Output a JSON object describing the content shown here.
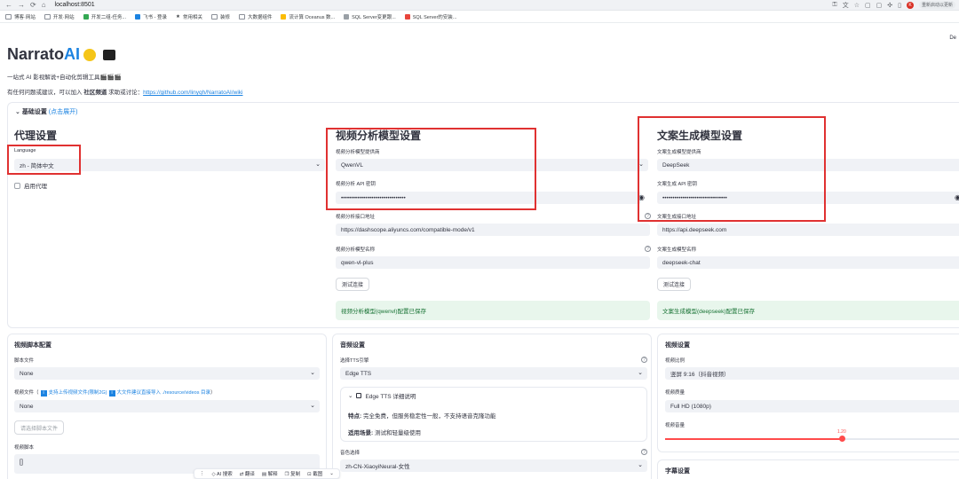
{
  "browser": {
    "url": "localhost:8501",
    "profile": "重新启动以更新",
    "avatar_letter": "K"
  },
  "bookmarks": [
    "博客·网站",
    "开发·网站",
    "开发二组-任务...",
    "飞书 - 登录",
    "常用相关",
    "装修",
    "大数据组件",
    "流计算 Oceanus 数...",
    "SQL Server变更跟...",
    "SQL Server的安装..."
  ],
  "app": {
    "deploy": "De",
    "title_prefix": "Narrato",
    "title_ai": "AI",
    "subtitle": "一站式 AI 影视解说+自动化剪辑工具🎬🎬🎬",
    "contact_text": "有任何问题或建议，可以加入 ",
    "contact_bold": "社区频道",
    "contact_mid": " 求助或讨论：",
    "contact_link": "https://github.com/linyqh/NarratoAI/wiki"
  },
  "basic_settings": {
    "label": "基础设置",
    "hint": "(点击展开)"
  },
  "proxy": {
    "title": "代理设置",
    "language_label": "Language",
    "language_value": "zh - 简体中文",
    "enable_proxy": "启用代理"
  },
  "video_model": {
    "title": "视频分析模型设置",
    "provider_label": "视频分析模型提供商",
    "provider_value": "QwenVL",
    "api_key_label": "视频分析 API 密钥",
    "api_key_value": "••••••••••••••••••••••••••••••••",
    "base_url_label": "视频分析接口地址",
    "base_url_value": "https://dashscope.aliyuncs.com/compatible-mode/v1",
    "model_name_label": "视频分析模型名称",
    "model_name_value": "qwen-vl-plus",
    "test_button": "测试连接",
    "status": "视频分析模型(qwenvl)配置已保存"
  },
  "text_model": {
    "title": "文案生成模型设置",
    "provider_label": "文案生成模型提供商",
    "provider_value": "DeepSeek",
    "api_key_label": "文案生成 API 密钥",
    "api_key_value": "••••••••••••••••••••••••••••••••",
    "base_url_label": "文案生成接口地址",
    "base_url_value": "https://api.deepseek.com",
    "model_name_label": "文案生成模型名称",
    "model_name_value": "deepseek-chat",
    "test_button": "测试连接",
    "status": "文案生成模型(deepseek)配置已保存"
  },
  "script_panel": {
    "title": "视频脚本配置",
    "script_file_label": "脚本文件",
    "script_file_value": "None",
    "video_file_label_pre": "视频文件（",
    "video_file_info1": "支持上传视频文件(限制2G)",
    "video_file_info2": "大文件建议直接导入 ./resource/videos 目录",
    "video_file_label_post": "）",
    "video_file_value": "None",
    "upload_button": "请选择脚本文件",
    "video_script_label": "视频脚本",
    "video_script_value": "[]"
  },
  "audio_panel": {
    "title": "音频设置",
    "tts_label": "选择TTS引擎",
    "tts_value": "Edge TTS",
    "detail_title": "Edge TTS 详细说明",
    "feature_key": "特点:",
    "feature_value": "完全免费，但服务稳定性一般，不支持语音克隆功能",
    "scene_key": "适用场景:",
    "scene_value": "测试和轻量级使用",
    "voice_label": "音色选择",
    "voice_value": "zh-CN-XiaoyiNeural-女性"
  },
  "video_panel": {
    "title": "视频设置",
    "ratio_label": "视频比例",
    "ratio_value": "竖屏 9:16（抖音视频）",
    "quality_label": "视频质量",
    "quality_value": "Full HD (1080p)",
    "volume_label": "视频音量",
    "volume_value": "1.20",
    "volume_fraction": 0.6,
    "subtitle_title": "字幕设置"
  },
  "float_bar": {
    "items": [
      "AI 搜索",
      "翻译",
      "解释",
      "复制",
      "截图"
    ]
  },
  "colors": {
    "accent": "#ff4b4b",
    "link": "#1c83e1",
    "success_bg": "#e8f6ec",
    "success_text": "#177233",
    "annotation": "#e03131"
  }
}
